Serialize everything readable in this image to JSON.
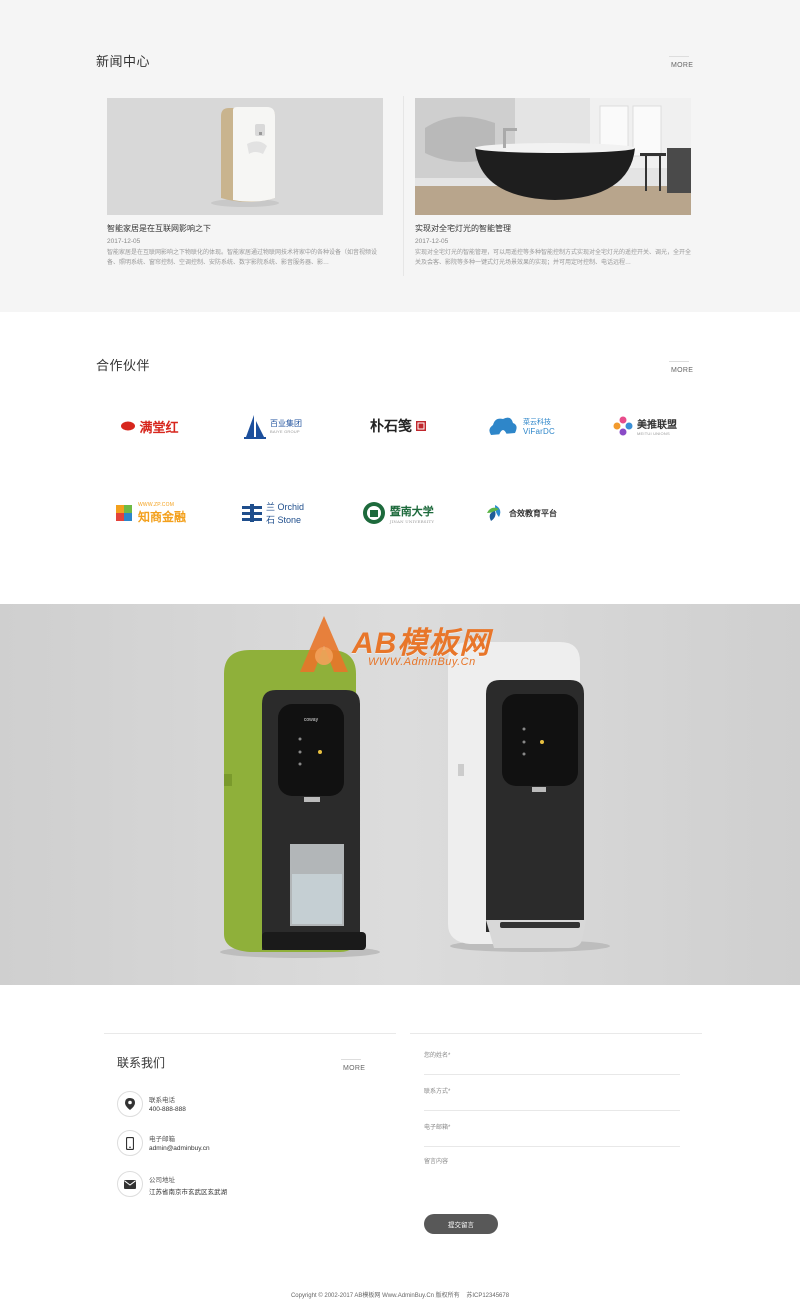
{
  "news": {
    "title": "新闻中心",
    "more": "MORE",
    "items": [
      {
        "title": "智能家居是在互联网影响之下",
        "date": "2017-12-05",
        "desc": "智能家居是在互联网影响之下物联化的体现。智能家居通过物联网技术将家中的各种设备（如音视频设备、照明系统、窗帘控制、空调控制、安防系统、数字影院系统、影音服务器、影…"
      },
      {
        "title": "实现对全宅灯光的智能管理",
        "date": "2017-12-05",
        "desc": "实现对全宅灯光的智能管理，可以用遥控等多种智能控制方式实现对全宅灯光的遥控开关、调光，全开全关及会客、影院等多种一键式灯光场景效果的实现；并可用定时控制、电话远程…"
      }
    ]
  },
  "partners": {
    "title": "合作伙伴",
    "more": "MORE",
    "logos": [
      {
        "name": "满堂红",
        "icon": "mantanghong-logo"
      },
      {
        "name": "百业集团",
        "sub": "BAIYE GROUP",
        "icon": "baiye-logo"
      },
      {
        "name": "朴石笺",
        "icon": "pushijian-logo"
      },
      {
        "name": "菜云科技",
        "sub": "ViFarDC",
        "icon": "caiyun-logo"
      },
      {
        "name": "美推联盟",
        "sub": "MEITUI UNIONS",
        "icon": "meitui-logo"
      },
      {
        "name": "知商金融",
        "sub": "WWW.ZP.COM",
        "icon": "zhishang-logo"
      },
      {
        "name": "Orchid",
        "sub": "Stone",
        "cn1": "兰",
        "cn2": "石",
        "icon": "orchid-stone-logo"
      },
      {
        "name": "暨南大学",
        "sub": "JINAN UNIVERSITY",
        "icon": "jinan-university-logo"
      },
      {
        "name": "合效教育平台",
        "icon": "hexiao-logo"
      }
    ]
  },
  "banner": {
    "watermark_text": "AB模板网",
    "watermark_url": "WWW.AdminBuy.Cn",
    "product_brand": "coway"
  },
  "contact": {
    "title": "联系我们",
    "more": "MORE",
    "items": [
      {
        "label": "联系电话",
        "value": "400-888-888",
        "icon": "location-pin-icon"
      },
      {
        "label": "电子邮箱",
        "value": "admin@adminbuy.cn",
        "icon": "mobile-phone-icon"
      },
      {
        "label": "公司地址",
        "value": "江苏省南京市玄武区玄武湖",
        "icon": "envelope-icon"
      }
    ],
    "form": {
      "name_placeholder": "您的姓名*",
      "phone_placeholder": "联系方式*",
      "email_placeholder": "电子邮箱*",
      "message_placeholder": "留言内容",
      "submit_label": "提交留言"
    }
  },
  "footer": {
    "copyright": "Copyright © 2002-2017 AB模板网 Www.AdminBuy.Cn 版权所有",
    "icp": "苏ICP12345678"
  },
  "colors": {
    "section_bg": "#f5f5f5",
    "banner_bg": "#d5d5d5",
    "watermark": "#e8762a",
    "button": "#585858",
    "green_device": "#97b73a"
  }
}
